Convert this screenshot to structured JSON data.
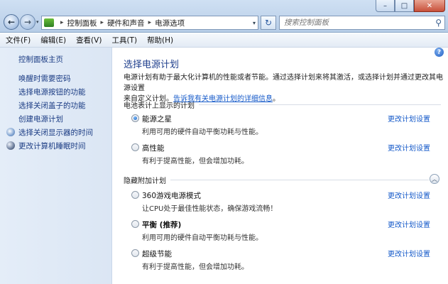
{
  "window": {
    "minimize_label": "–",
    "maximize_label": "□",
    "close_label": "✕"
  },
  "nav": {
    "back_symbol": "←",
    "forward_symbol": "→",
    "dropdown_symbol": "▾",
    "refresh_symbol": "↻"
  },
  "address": {
    "crumbs": [
      "控制面板",
      "硬件和声音",
      "电源选项"
    ],
    "separator": "▸",
    "dropdown_symbol": "▾"
  },
  "search": {
    "placeholder": "搜索控制面板",
    "icon": "search-icon",
    "icon_glyph": "⚲"
  },
  "menu": {
    "file": "文件(F)",
    "edit": "编辑(E)",
    "view": "查看(V)",
    "tools": "工具(T)",
    "help": "帮助(H)"
  },
  "sidebar": {
    "home": "控制面板主页",
    "items": [
      "唤醒时需要密码",
      "选择电源按钮的功能",
      "选择关闭盖子的功能",
      "创建电源计划",
      "选择关闭显示器的时间",
      "更改计算机睡眠时间"
    ]
  },
  "main": {
    "help_glyph": "?",
    "title": "选择电源计划",
    "desc_line1": "电源计划有助于最大化计算机的性能或者节能。通过选择计划来将其激活，或选择计划并通过更改其电源设置",
    "desc_line2_prefix": "来自定义计划。",
    "desc_link": "告诉我有关电源计划的详细信息",
    "desc_line2_suffix": "。",
    "group1_title": "电池表计上显示的计划",
    "group2_title": "隐藏附加计划",
    "collapse_glyph": "︿",
    "change_label": "更改计划设置",
    "plans": [
      {
        "name": "能源之星",
        "desc": "利用可用的硬件自动平衡功耗与性能。",
        "selected": true
      },
      {
        "name": "高性能",
        "desc": "有利于提高性能，但会增加功耗。",
        "selected": false
      },
      {
        "name": "360游戏电源模式",
        "desc": "让CPU处于最佳性能状态，确保游戏流畅！",
        "selected": false
      },
      {
        "name": "平衡 (推荐)",
        "desc": "利用可用的硬件自动平衡功耗与性能。",
        "selected": false
      },
      {
        "name": "超级节能",
        "desc": "有利于提高性能，但会增加功耗。",
        "selected": false
      }
    ]
  },
  "colors": {
    "link": "#1459c9",
    "title": "#1e3e8c",
    "sidebar_text": "#1a3b83"
  }
}
